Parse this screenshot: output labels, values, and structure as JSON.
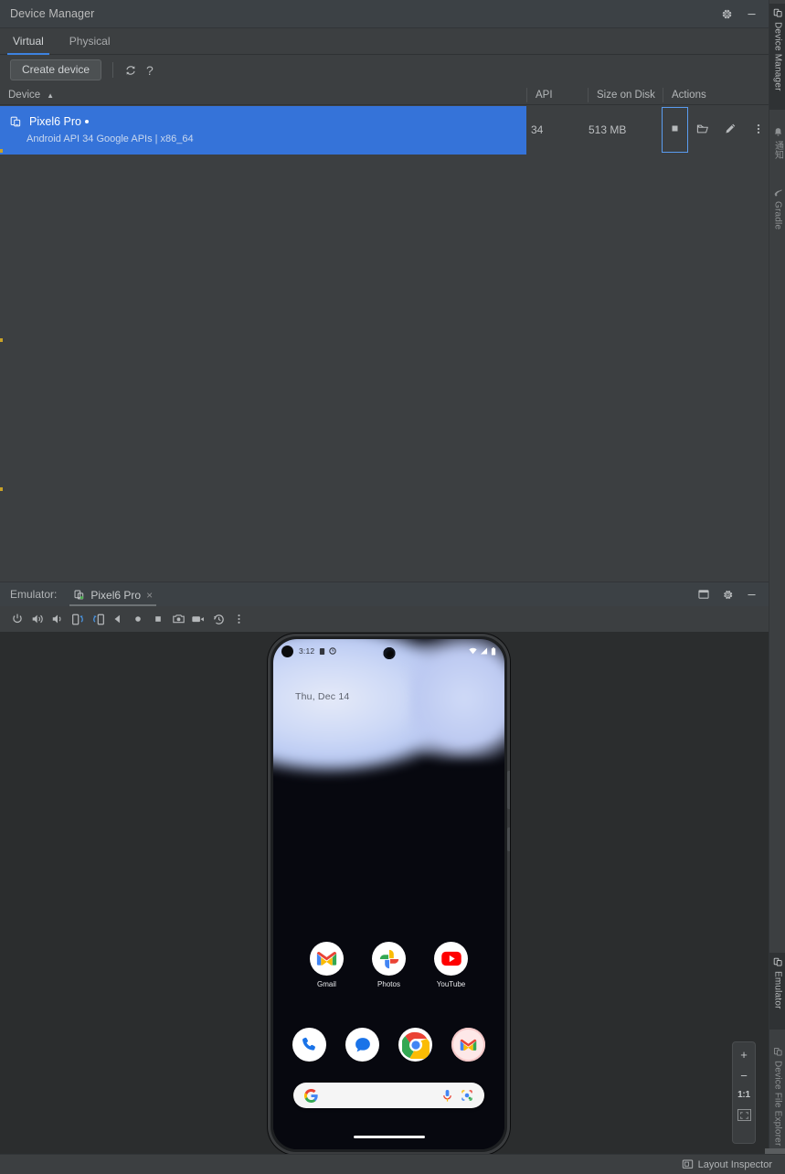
{
  "device_manager": {
    "title": "Device Manager",
    "settings_icon": "gear-icon",
    "minimize_icon": "minimize-icon",
    "tabs": [
      {
        "label": "Virtual",
        "active": true
      },
      {
        "label": "Physical",
        "active": false
      }
    ],
    "toolbar": {
      "create_device_label": "Create device",
      "refresh_icon": "refresh-icon",
      "help_label": "?"
    },
    "table": {
      "columns": [
        {
          "label": "Device",
          "sort": "ascending",
          "sort_glyph": "▲"
        },
        {
          "label": "API"
        },
        {
          "label": "Size on Disk"
        },
        {
          "label": "Actions"
        }
      ],
      "rows": [
        {
          "device_icon": "virtual-device-icon",
          "name": "Pixel6 Pro",
          "running_indicator": "•",
          "subtitle": "Android API 34 Google APIs | x86_64",
          "api": "34",
          "size_on_disk": "513 MB",
          "selected": true,
          "actions": [
            {
              "icon": "stop-icon",
              "focused": true
            },
            {
              "icon": "folder-icon",
              "focused": false
            },
            {
              "icon": "edit-pencil-icon",
              "focused": false
            },
            {
              "icon": "overflow-menu-icon",
              "focused": false
            }
          ]
        }
      ]
    }
  },
  "emulator_panel": {
    "label": "Emulator:",
    "tab": {
      "device_icon": "running-device-icon",
      "name": "Pixel6 Pro",
      "close_glyph": "×"
    },
    "header_actions": [
      {
        "icon": "separate-window-icon"
      },
      {
        "icon": "gear-icon"
      },
      {
        "icon": "minimize-icon"
      }
    ],
    "toolbar_buttons": [
      {
        "icon": "power-icon"
      },
      {
        "icon": "volume-up-icon"
      },
      {
        "icon": "volume-down-icon"
      },
      {
        "icon": "rotate-left-icon"
      },
      {
        "icon": "rotate-right-icon"
      },
      {
        "icon": "back-icon"
      },
      {
        "icon": "home-icon"
      },
      {
        "icon": "overview-icon"
      },
      {
        "icon": "screenshot-camera-icon"
      },
      {
        "icon": "screen-record-icon"
      },
      {
        "icon": "history-icon"
      },
      {
        "icon": "overflow-menu-icon"
      }
    ],
    "zoom_controls": [
      {
        "label": "+",
        "name": "zoom-in-button"
      },
      {
        "label": "−",
        "name": "zoom-out-button"
      },
      {
        "label": "1:1",
        "name": "zoom-actual-button"
      },
      {
        "label": "",
        "name": "zoom-fit-button"
      }
    ]
  },
  "phone": {
    "status_bar": {
      "time": "3:12",
      "left_icons": [
        "clipboard-icon",
        "clock-icon"
      ],
      "right_icons": [
        "wifi-icon",
        "signal-icon",
        "battery-icon"
      ]
    },
    "date_widget": "Thu, Dec 14",
    "apps": [
      {
        "label": "Gmail",
        "icon": "gmail-icon"
      },
      {
        "label": "Photos",
        "icon": "google-photos-icon"
      },
      {
        "label": "YouTube",
        "icon": "youtube-icon"
      }
    ],
    "dock": [
      {
        "icon": "phone-dialer-icon",
        "label": "Phone"
      },
      {
        "icon": "messages-icon",
        "label": "Messages"
      },
      {
        "icon": "chrome-icon",
        "label": "Chrome"
      },
      {
        "icon": "gmail-icon",
        "label": "Gmail"
      }
    ],
    "search": {
      "google_icon": "google-g-icon",
      "mic_icon": "microphone-icon",
      "lens_icon": "google-lens-icon",
      "placeholder": ""
    },
    "gesture_bar": "home-gesture-pill"
  },
  "right_rail": {
    "tabs": [
      {
        "label": "Device Manager",
        "icon": "device-manager-icon",
        "active": true
      },
      {
        "label": "通知",
        "icon": "notifications-bell-icon",
        "active": false
      },
      {
        "label": "Gradle",
        "icon": "gradle-icon",
        "active": false
      },
      {
        "label": "Emulator",
        "icon": "emulator-icon",
        "active": true
      },
      {
        "label": "Device File Explorer",
        "icon": "device-file-explorer-icon",
        "active": false
      }
    ]
  },
  "status_bar_bottom": {
    "layout_inspector_label": "Layout Inspector",
    "layout_inspector_icon": "layout-inspector-icon"
  },
  "colors": {
    "accent_blue": "#3573d9",
    "tab_underline": "#3d82e0",
    "panel_bg": "#3c3f41",
    "header_bg": "#3c4145",
    "stage_bg": "#2b2d2e",
    "focus_outline": "#5a9cf0",
    "marker_yellow": "#c9a227"
  }
}
